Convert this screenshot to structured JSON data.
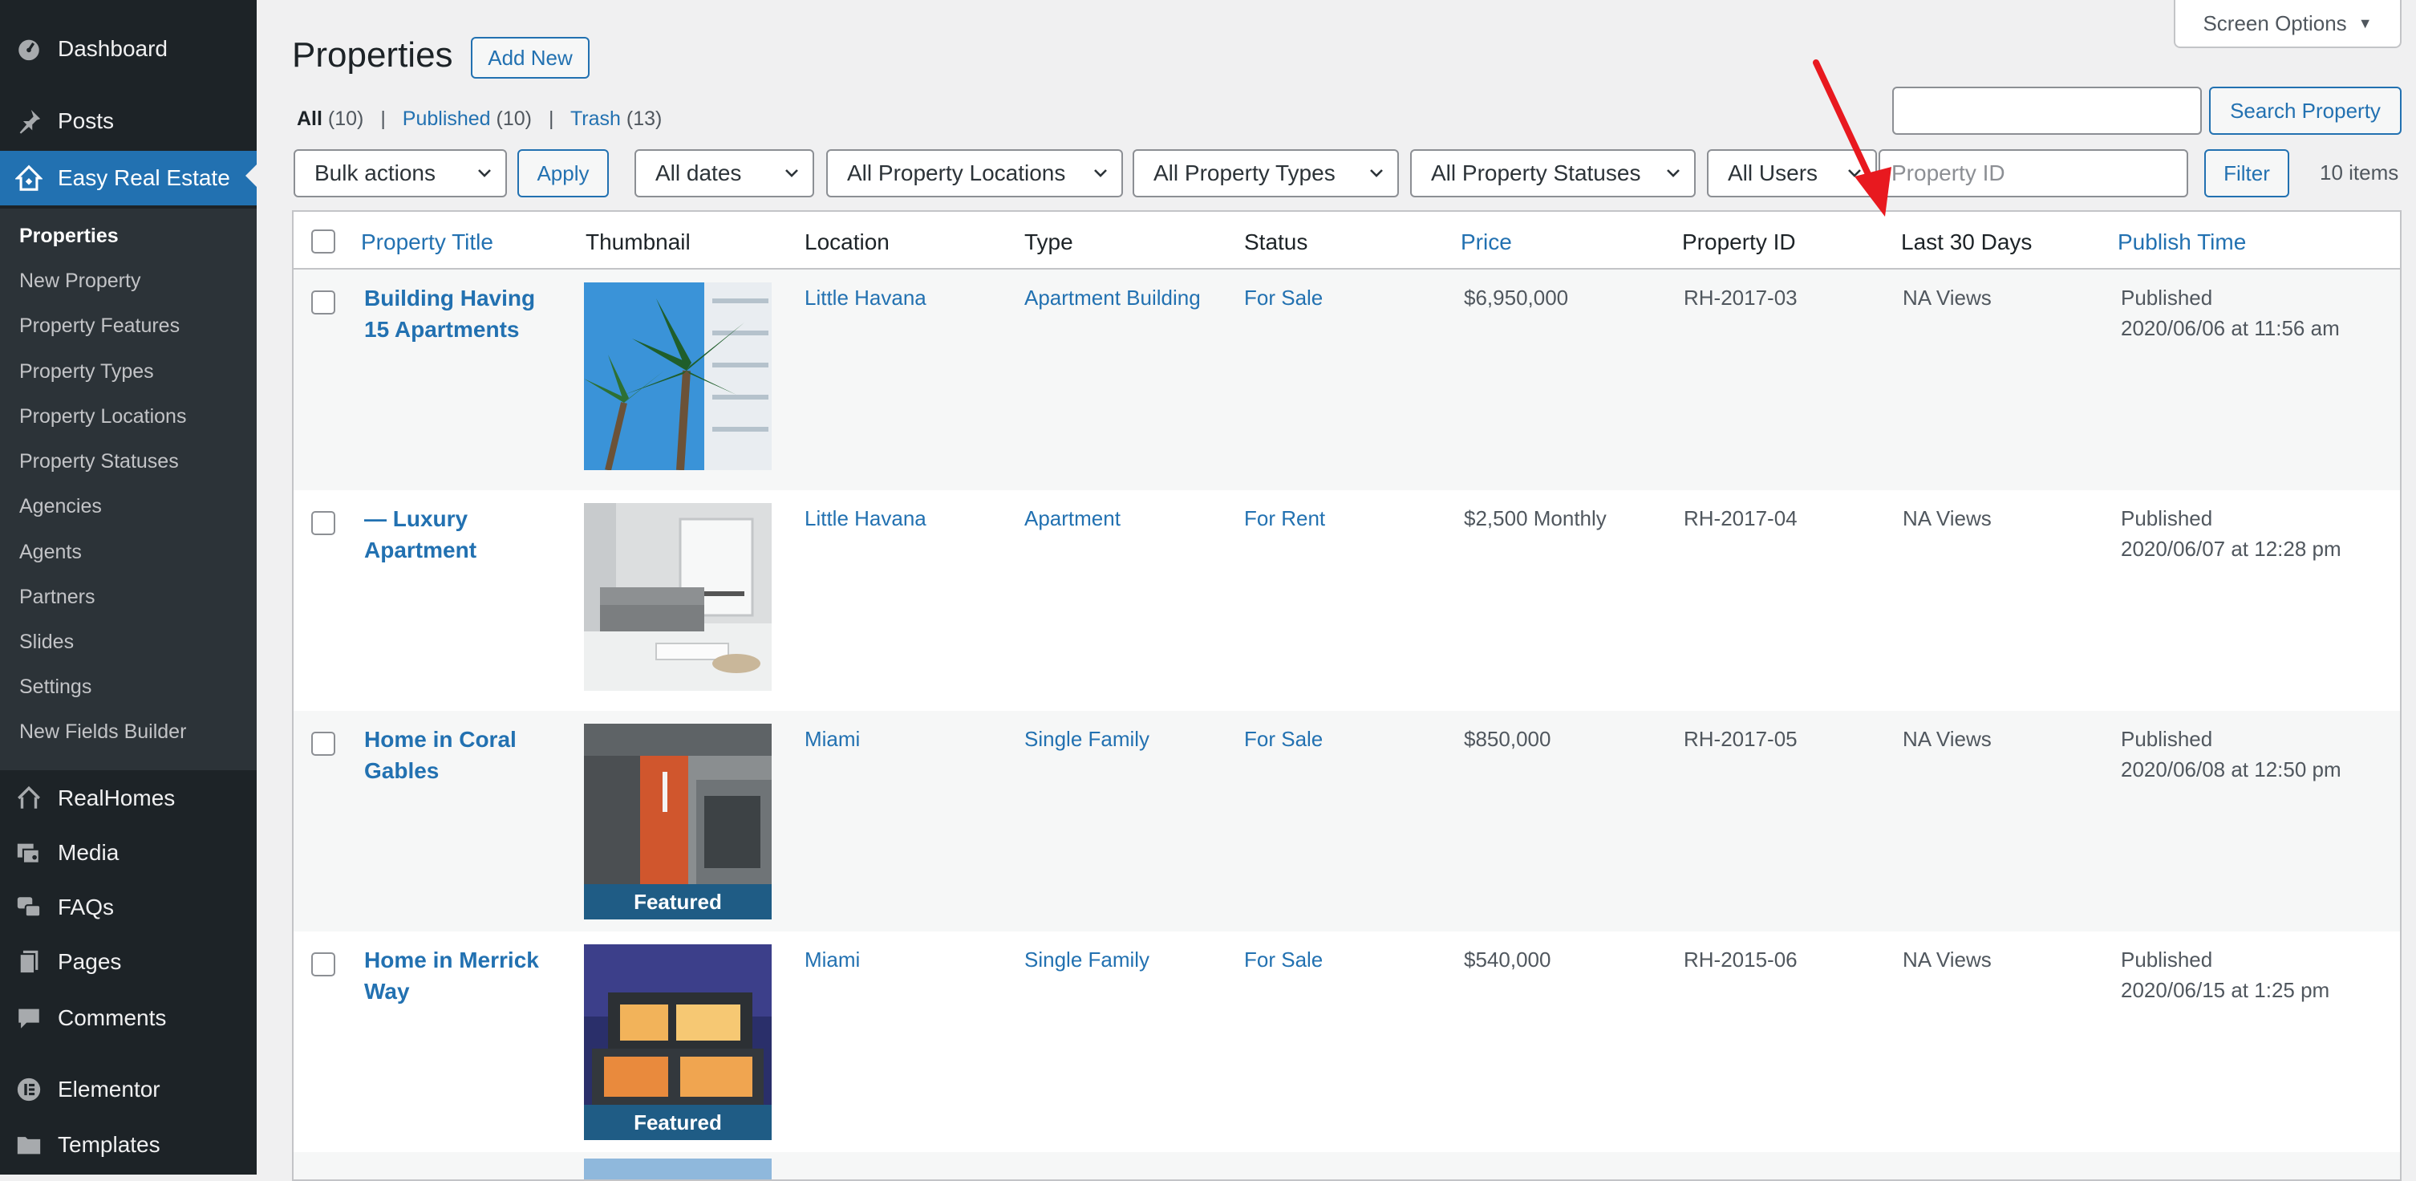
{
  "sidebar": {
    "top_items": [
      {
        "label": "Dashboard",
        "icon": "dashboard-icon"
      },
      {
        "label": "Posts",
        "icon": "pin-icon"
      },
      {
        "label": "Easy Real Estate",
        "icon": "house-icon"
      }
    ],
    "submenu": [
      "Properties",
      "New Property",
      "Property Features",
      "Property Types",
      "Property Locations",
      "Property Statuses",
      "Agencies",
      "Agents",
      "Partners",
      "Slides",
      "Settings",
      "New Fields Builder"
    ],
    "bottom_items": [
      {
        "label": "RealHomes",
        "icon": "realhomes-icon"
      },
      {
        "label": "Media",
        "icon": "media-icon"
      },
      {
        "label": "FAQs",
        "icon": "faqs-icon"
      },
      {
        "label": "Pages",
        "icon": "pages-icon"
      },
      {
        "label": "Comments",
        "icon": "comments-icon"
      },
      {
        "label": "Elementor",
        "icon": "elementor-icon"
      },
      {
        "label": "Templates",
        "icon": "folder-icon"
      }
    ]
  },
  "header": {
    "title": "Properties",
    "add_new": "Add New",
    "screen_options": "Screen Options"
  },
  "views": {
    "all": "All",
    "all_count": "(10)",
    "published": "Published",
    "published_count": "(10)",
    "trash": "Trash",
    "trash_count": "(13)",
    "separator": "|"
  },
  "search": {
    "value": "",
    "button": "Search Property"
  },
  "filters": {
    "bulk_actions": "Bulk actions",
    "apply": "Apply",
    "dates": "All dates",
    "locations": "All Property Locations",
    "types": "All Property Types",
    "statuses": "All Property Statuses",
    "users": "All Users",
    "property_id_placeholder": "Property ID",
    "filter": "Filter",
    "items_count": "10 items"
  },
  "table": {
    "columns": [
      "Property Title",
      "Thumbnail",
      "Location",
      "Type",
      "Status",
      "Price",
      "Property ID",
      "Last 30 Days",
      "Publish Time"
    ],
    "rows": [
      {
        "title": "Building Having 15 Apartments",
        "location": "Little Havana",
        "type": "Apartment Building",
        "status": "For Sale",
        "price": "$6,950,000",
        "property_id": "RH-2017-03",
        "views": "NA Views",
        "published": "Published",
        "publish_time": "2020/06/06 at 11:56 am",
        "featured": "",
        "thumb": "palm-trees-photo"
      },
      {
        "title": "— Luxury Apartment",
        "location": "Little Havana",
        "type": "Apartment",
        "status": "For Rent",
        "price": "$2,500 Monthly",
        "property_id": "RH-2017-04",
        "views": "NA Views",
        "published": "Published",
        "publish_time": "2020/06/07 at 12:28 pm",
        "featured": "",
        "thumb": "interior-photo"
      },
      {
        "title": "Home in Coral Gables",
        "location": "Miami",
        "type": "Single Family",
        "status": "For Sale",
        "price": "$850,000",
        "property_id": "RH-2017-05",
        "views": "NA Views",
        "published": "Published",
        "publish_time": "2020/06/08 at 12:50 pm",
        "featured": "Featured",
        "thumb": "modern-house-photo"
      },
      {
        "title": "Home in Merrick Way",
        "location": "Miami",
        "type": "Single Family",
        "status": "For Sale",
        "price": "$540,000",
        "property_id": "RH-2015-06",
        "views": "NA Views",
        "published": "Published",
        "publish_time": "2020/06/15 at 1:25 pm",
        "featured": "Featured",
        "thumb": "night-house-photo"
      }
    ]
  },
  "colors": {
    "sidebar_bg": "#1d2327",
    "submenu_bg": "#2c3338",
    "accent": "#2271b1",
    "annotation_arrow": "#e8191f"
  }
}
